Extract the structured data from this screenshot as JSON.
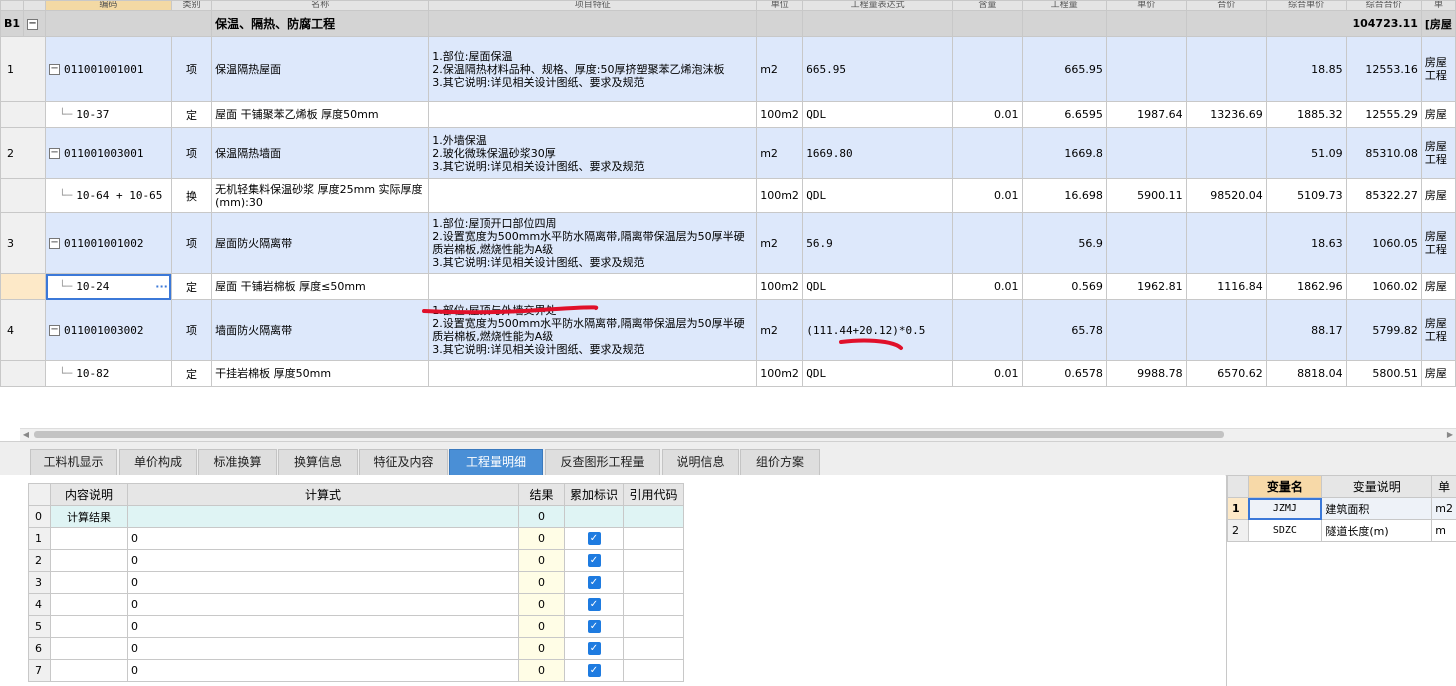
{
  "top_grid": {
    "headers": [
      "编码",
      "类别",
      "名称",
      "项目特征",
      "单位",
      "工程量表达式",
      "含量",
      "工程量",
      "单价",
      "合价",
      "综合单价",
      "综合合价",
      "单"
    ],
    "section": {
      "code": "B1",
      "toggle": "−",
      "name": "保温、隔热、防腐工程",
      "total": "104723.11",
      "extra": "[房屋"
    },
    "rows": [
      {
        "no": "1",
        "kind": "item",
        "code": "011001001001",
        "type": "项",
        "name": "保温隔热屋面",
        "features": [
          "1.部位:屋面保温",
          "2.保温隔热材料品种、规格、厚度:50厚挤塑聚苯乙烯泡沫板",
          "3.其它说明:详见相关设计图纸、要求及规范"
        ],
        "unit": "m2",
        "expr": "665.95",
        "content": "",
        "qty": "665.95",
        "price": "",
        "amount": "",
        "unit_total": "18.85",
        "total": "12553.16",
        "extra": "房屋工程"
      },
      {
        "no": "",
        "kind": "quota",
        "code": "10-37",
        "type": "定",
        "name": "屋面 干铺聚苯乙烯板 厚度50mm",
        "features": [],
        "unit": "100m2",
        "expr": "QDL",
        "content": "0.01",
        "qty": "6.6595",
        "price": "1987.64",
        "amount": "13236.69",
        "unit_total": "1885.32",
        "total": "12555.29",
        "extra": "房屋"
      },
      {
        "no": "2",
        "kind": "item",
        "code": "011001003001",
        "type": "项",
        "name": "保温隔热墙面",
        "features": [
          "1.外墙保温",
          "2.玻化微珠保温砂浆30厚",
          "3.其它说明:详见相关设计图纸、要求及规范"
        ],
        "unit": "m2",
        "expr": "1669.80",
        "content": "",
        "qty": "1669.8",
        "price": "",
        "amount": "",
        "unit_total": "51.09",
        "total": "85310.08",
        "extra": "房屋工程"
      },
      {
        "no": "",
        "kind": "quota",
        "code": "10-64 + 10-65",
        "type": "换",
        "name": "无机轻集料保温砂浆 厚度25mm  实际厚度(mm):30",
        "features": [],
        "unit": "100m2",
        "expr": "QDL",
        "content": "0.01",
        "qty": "16.698",
        "price": "5900.11",
        "amount": "98520.04",
        "unit_total": "5109.73",
        "total": "85322.27",
        "extra": "房屋"
      },
      {
        "no": "3",
        "kind": "item",
        "code": "011001001002",
        "type": "项",
        "name": "屋面防火隔离带",
        "features": [
          "1.部位:屋顶开口部位四周",
          "2.设置宽度为500mm水平防水隔离带,隔离带保温层为50厚半硬质岩棉板,燃烧性能为A级",
          "3.其它说明:详见相关设计图纸、要求及规范"
        ],
        "unit": "m2",
        "expr": "56.9",
        "content": "",
        "qty": "56.9",
        "price": "",
        "amount": "",
        "unit_total": "18.63",
        "total": "1060.05",
        "extra": "房屋工程"
      },
      {
        "no": "",
        "kind": "quota",
        "code": "10-24",
        "type": "定",
        "name": "屋面 干铺岩棉板 厚度≤50mm",
        "features": [],
        "unit": "100m2",
        "expr": "QDL",
        "content": "0.01",
        "qty": "0.569",
        "price": "1962.81",
        "amount": "1116.84",
        "unit_total": "1862.96",
        "total": "1060.02",
        "extra": "房屋",
        "selected": true
      },
      {
        "no": "4",
        "kind": "item",
        "code": "011001003002",
        "type": "项",
        "name": "墙面防火隔离带",
        "features": [
          "1.部位:屋顶与外墙交界处",
          "2.设置宽度为500mm水平防水隔离带,隔离带保温层为50厚半硬质岩棉板,燃烧性能为A级",
          "3.其它说明:详见相关设计图纸、要求及规范"
        ],
        "unit": "m2",
        "expr": "(111.44+20.12)*0.5",
        "content": "",
        "qty": "65.78",
        "price": "",
        "amount": "",
        "unit_total": "88.17",
        "total": "5799.82",
        "extra": "房屋工程"
      },
      {
        "no": "",
        "kind": "quota",
        "code": "10-82",
        "type": "定",
        "name": "干挂岩棉板 厚度50mm",
        "features": [],
        "unit": "100m2",
        "expr": "QDL",
        "content": "0.01",
        "qty": "0.6578",
        "price": "9988.78",
        "amount": "6570.62",
        "unit_total": "8818.04",
        "total": "5800.51",
        "extra": "房屋"
      }
    ]
  },
  "tabs": [
    "工料机显示",
    "单价构成",
    "标准换算",
    "换算信息",
    "特征及内容",
    "工程量明细",
    "反查图形工程量",
    "说明信息",
    "组价方案"
  ],
  "active_tab": "工程量明细",
  "calc_grid": {
    "headers": [
      "内容说明",
      "计算式",
      "结果",
      "累加标识",
      "引用代码"
    ],
    "rows": [
      {
        "no": "0",
        "desc": "计算结果",
        "formula": "",
        "result": "0",
        "checked": false
      },
      {
        "no": "1",
        "desc": "",
        "formula": "0",
        "result": "0",
        "checked": true
      },
      {
        "no": "2",
        "desc": "",
        "formula": "0",
        "result": "0",
        "checked": true
      },
      {
        "no": "3",
        "desc": "",
        "formula": "0",
        "result": "0",
        "checked": true
      },
      {
        "no": "4",
        "desc": "",
        "formula": "0",
        "result": "0",
        "checked": true
      },
      {
        "no": "5",
        "desc": "",
        "formula": "0",
        "result": "0",
        "checked": true
      },
      {
        "no": "6",
        "desc": "",
        "formula": "0",
        "result": "0",
        "checked": true
      },
      {
        "no": "7",
        "desc": "",
        "formula": "0",
        "result": "0",
        "checked": true
      }
    ]
  },
  "var_grid": {
    "headers": [
      "变量名",
      "变量说明",
      "单"
    ],
    "rows": [
      {
        "no": "1",
        "name": "JZMJ",
        "desc": "建筑面积",
        "unit": "m2"
      },
      {
        "no": "2",
        "name": "SDZC",
        "desc": "隧道长度(m)",
        "unit": "m"
      }
    ]
  },
  "colors": {
    "accent": "#4a8fd6",
    "item_row": "#dde8fb",
    "section_row": "#d4d4d4",
    "annotation": "#e0102a"
  }
}
